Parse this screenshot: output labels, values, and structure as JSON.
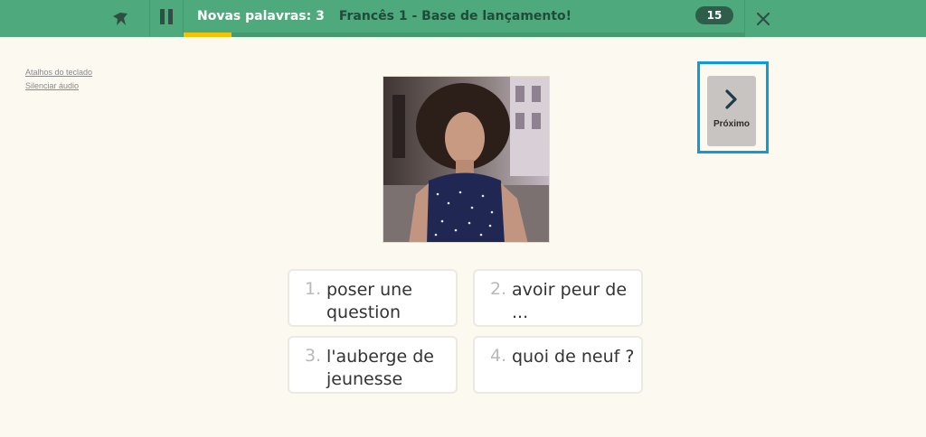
{
  "header": {
    "new_words": "Novas palavras: 3",
    "course_title": "Francês 1 - Base de lançamento!",
    "count": "15",
    "progress_fraction": 0.085
  },
  "side_links": {
    "keyboard_shortcuts": "Atalhos do teclado",
    "mute_audio": "Silenciar áudio"
  },
  "next_button": {
    "label": "Próximo"
  },
  "options": [
    {
      "number": "1.",
      "text": "poser une question"
    },
    {
      "number": "2.",
      "text": "avoir peur de ..."
    },
    {
      "number": "3.",
      "text": "l'auberge de jeunesse"
    },
    {
      "number": "4.",
      "text": "quoi de neuf ?"
    }
  ],
  "colors": {
    "header_bg": "#4eaa7c",
    "progress": "#f5c400",
    "highlight": "#0e9bd9",
    "background": "#fcf9f1"
  },
  "icons": {
    "logo": "memrise-logo-icon",
    "pause": "pause-icon",
    "close": "close-icon",
    "next": "chevron-right-icon"
  }
}
